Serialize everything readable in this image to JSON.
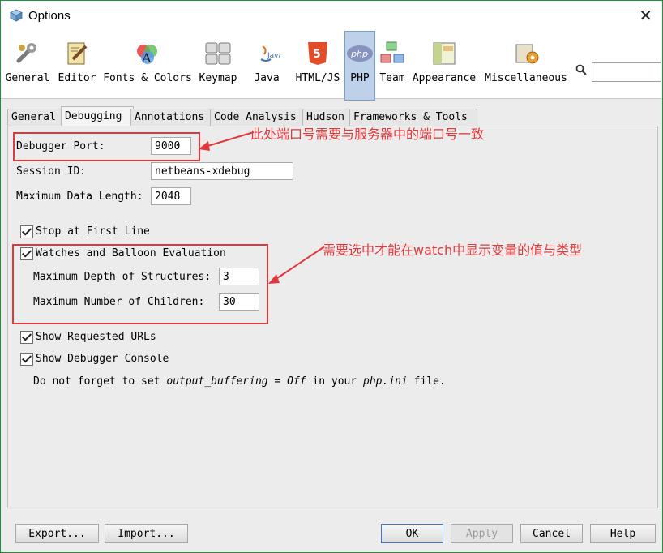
{
  "window": {
    "title": "Options"
  },
  "categories": [
    {
      "label": "General",
      "icon": "wrench-icon"
    },
    {
      "label": "Editor",
      "icon": "editor-icon"
    },
    {
      "label": "Fonts & Colors",
      "icon": "fonts-colors-icon"
    },
    {
      "label": "Keymap",
      "icon": "keymap-icon"
    },
    {
      "label": "Java",
      "icon": "java-icon"
    },
    {
      "label": "HTML/JS",
      "icon": "html5-icon"
    },
    {
      "label": "PHP",
      "icon": "php-icon"
    },
    {
      "label": "Team",
      "icon": "team-icon"
    },
    {
      "label": "Appearance",
      "icon": "appearance-icon"
    },
    {
      "label": "Miscellaneous",
      "icon": "miscellaneous-icon"
    }
  ],
  "tabs": [
    {
      "label": "General"
    },
    {
      "label": "Debugging"
    },
    {
      "label": "Annotations"
    },
    {
      "label": "Code Analysis"
    },
    {
      "label": "Hudson"
    },
    {
      "label": "Frameworks & Tools"
    }
  ],
  "form": {
    "debugger_port_label": "Debugger Port:",
    "debugger_port_value": "9000",
    "session_id_label": "Session ID:",
    "session_id_value": "netbeans-xdebug",
    "max_data_length_label": "Maximum Data Length:",
    "max_data_length_value": "2048",
    "stop_first_line_label": "Stop at First Line",
    "watches_label": "Watches and Balloon Evaluation",
    "max_depth_label": "Maximum Depth of Structures:",
    "max_depth_value": "3",
    "max_children_label": "Maximum Number of Children:",
    "max_children_value": "30",
    "show_urls_label": "Show Requested URLs",
    "show_console_label": "Show Debugger Console",
    "note_prefix": "Do not forget to set ",
    "note_setting": "output_buffering = Off",
    "note_middle": " in your ",
    "note_file": "php.ini",
    "note_suffix": " file."
  },
  "annotations": {
    "port_note": "此处端口号需要与服务器中的端口号一致",
    "watch_note": "需要选中才能在watch中显示变量的值与类型"
  },
  "buttons": {
    "export": "Export...",
    "import": "Import...",
    "ok": "OK",
    "apply": "Apply",
    "cancel": "Cancel",
    "help": "Help"
  },
  "colors": {
    "annotation": "#e0383b",
    "active_category": "#bdd2ea"
  }
}
